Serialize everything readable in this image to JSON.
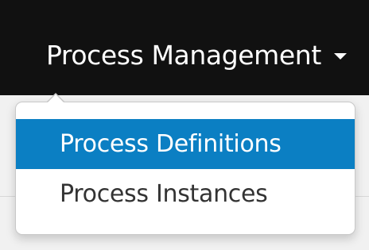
{
  "navbar": {
    "menu_label": "Process Management",
    "caret_icon": "caret-down-icon",
    "background_color": "#111111",
    "text_color": "#ffffff"
  },
  "dropdown": {
    "items": [
      {
        "label": "Process Definitions",
        "active": true
      },
      {
        "label": "Process Instances",
        "active": false
      }
    ],
    "active_color": "#0b7fc3"
  }
}
